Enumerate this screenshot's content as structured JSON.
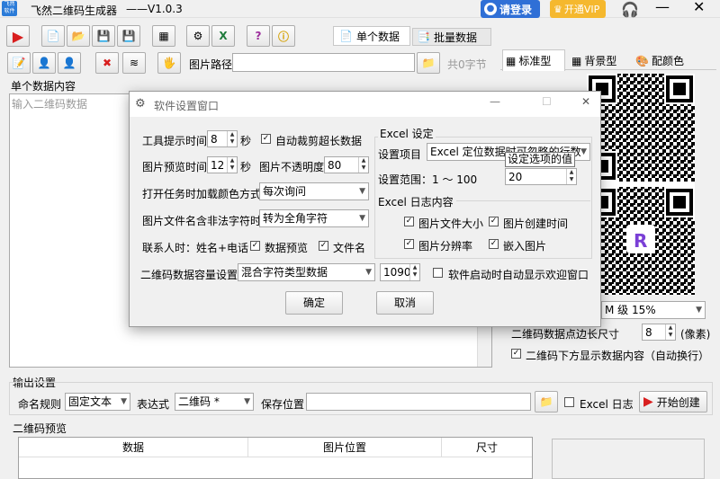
{
  "app": {
    "logo_text": "飞然软件",
    "title": "飞然二维码生成器",
    "version": "——V1.0.3",
    "login": "请登录",
    "vip": "开通VIP"
  },
  "tabs": {
    "single": "单个数据",
    "batch": "批量数据"
  },
  "toolbar2": {
    "image_path_label": "图片路径",
    "image_path_value": "",
    "char_count": "共0字节"
  },
  "single": {
    "group_title": "单个数据内容",
    "placeholder": "输入二维码数据"
  },
  "right_tabs": {
    "standard": "标准型",
    "background": "背景型",
    "color": "配颜色"
  },
  "qr_options": {
    "ecc": "M 级 15%",
    "dot_size_label": "二维码数据点边长尺寸",
    "dot_size": "8",
    "pixel_label": "(像素)",
    "show_text_label": "二维码下方显示数据内容（自动换行）"
  },
  "output": {
    "group_title": "输出设置",
    "naming_label": "命名规则",
    "naming_value": "固定文本",
    "expr_label": "表达式",
    "expr_value": "二维码 *",
    "save_label": "保存位置",
    "save_value": "",
    "excel_log": "Excel 日志",
    "start": "开始创建"
  },
  "preview": {
    "group_title": "二维码预览",
    "columns": [
      "数据",
      "图片位置",
      "尺寸"
    ]
  },
  "dialog": {
    "title": "软件设置窗口",
    "tooltip_time_label": "工具提示时间",
    "tooltip_time": "8",
    "sec1": "秒",
    "auto_crop": "自动裁剪超长数据",
    "preview_time_label": "图片预览时间",
    "preview_time": "12",
    "sec2": "秒",
    "opacity_label": "图片不透明度",
    "opacity": "80",
    "color_mode_label": "打开任务时加载颜色方式",
    "color_mode": "每次询问",
    "illegal_char_label": "图片文件名含非法字符时",
    "illegal_char": "转为全角字符",
    "contact_label": "联系人时：姓名+电话",
    "data_preview": "数据预览",
    "file_name": "文件名",
    "capacity_label": "二维码数据容量设置",
    "capacity_mode": "混合字符类型数据",
    "capacity": "1090",
    "welcome": "软件启动时自动显示欢迎窗口",
    "excel_group": "Excel 设定",
    "setting_item_label": "设置项目",
    "setting_item": "Excel 定位数据时可忽略的行数",
    "tooltip_popup": "设定选项的值",
    "range_label": "设置范围：1 ～ 100",
    "range_value": "20",
    "excel_log_group": "Excel 日志内容",
    "log_size": "图片文件大小",
    "log_ctime": "图片创建时间",
    "log_res": "图片分辨率",
    "log_embed": "嵌入图片",
    "ok": "确定",
    "cancel": "取消"
  }
}
